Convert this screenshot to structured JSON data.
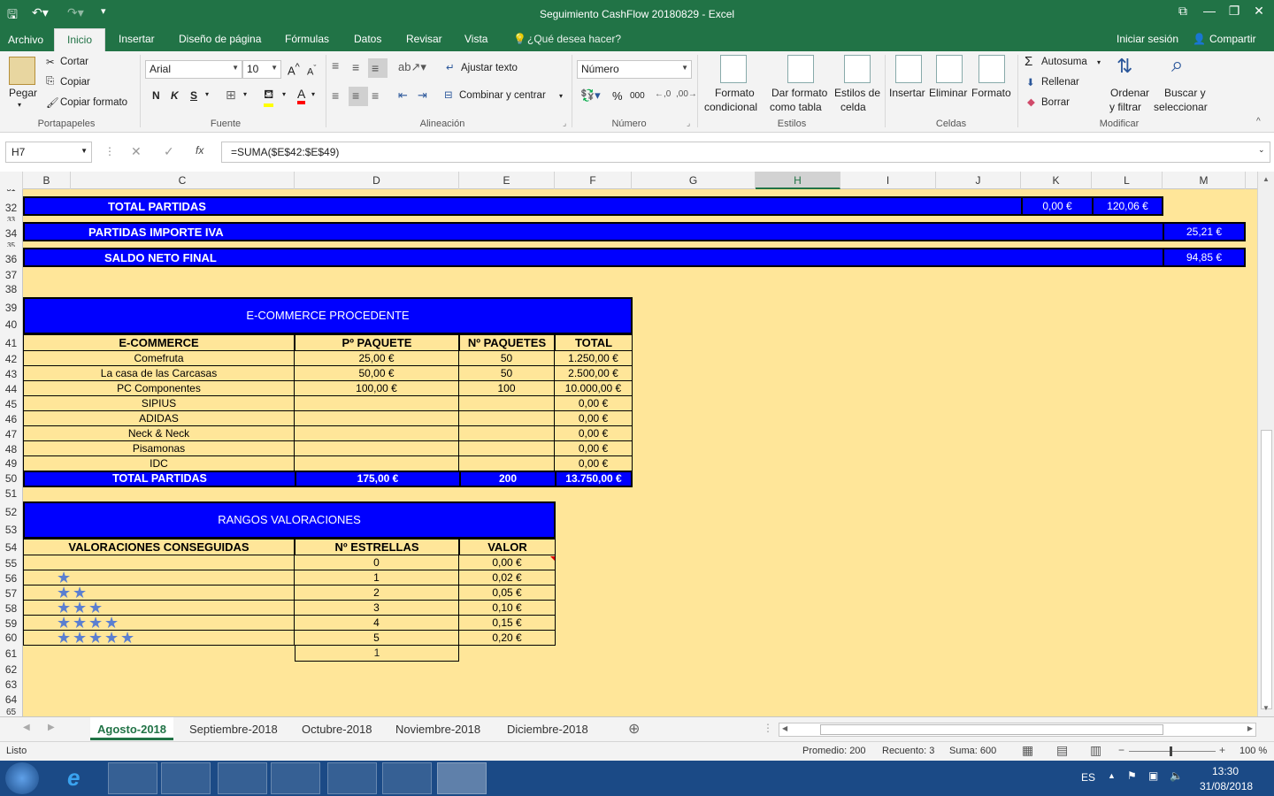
{
  "window": {
    "title": "Seguimiento CashFlow 20180829 - Excel"
  },
  "ribbon_tabs": [
    "Archivo",
    "Inicio",
    "Insertar",
    "Diseño de página",
    "Fórmulas",
    "Datos",
    "Revisar",
    "Vista"
  ],
  "tell_me": "¿Qué desea hacer?",
  "signin": "Iniciar sesión",
  "share": "Compartir",
  "clipboard": {
    "paste": "Pegar",
    "cut": "Cortar",
    "copy": "Copiar",
    "format_painter": "Copiar formato",
    "label": "Portapapeles"
  },
  "font": {
    "name": "Arial",
    "size": "10",
    "label": "Fuente",
    "bold": "N",
    "italic": "K",
    "underline": "S"
  },
  "alignment": {
    "wrap": "Ajustar texto",
    "merge": "Combinar y centrar",
    "label": "Alineación"
  },
  "number": {
    "format": "Número",
    "label": "Número",
    "percent": "%",
    "thousands": "000"
  },
  "styles": {
    "cond1": "Formato",
    "cond2": "condicional",
    "table1": "Dar formato",
    "table2": "como tabla",
    "cell1": "Estilos de",
    "cell2": "celda",
    "label": "Estilos"
  },
  "cells": {
    "insert": "Insertar",
    "delete": "Eliminar",
    "format": "Formato",
    "label": "Celdas"
  },
  "editing": {
    "autosum": "Autosuma",
    "fill": "Rellenar",
    "clear": "Borrar",
    "sort1": "Ordenar",
    "sort2": "y filtrar",
    "find1": "Buscar y",
    "find2": "seleccionar",
    "label": "Modificar"
  },
  "formula_bar": {
    "name_box": "H7",
    "fx": "fx",
    "formula": "=SUMA($E$42:$E$49)"
  },
  "columns": [
    "B",
    "C",
    "D",
    "E",
    "F",
    "G",
    "H",
    "I",
    "J",
    "K",
    "L",
    "M"
  ],
  "rows": [
    "31",
    "32",
    "33",
    "34",
    "35",
    "36",
    "37",
    "38",
    "39",
    "40",
    "41",
    "42",
    "43",
    "44",
    "45",
    "46",
    "47",
    "48",
    "49",
    "50",
    "51",
    "52",
    "53",
    "54",
    "55",
    "56",
    "57",
    "58",
    "59",
    "60",
    "61",
    "62",
    "63",
    "64",
    "65"
  ],
  "summary": {
    "total_partidas": "TOTAL PARTIDAS",
    "k32": "0,00 €",
    "l32": "120,06 €",
    "iva": "PARTIDAS IMPORTE IVA",
    "m34": "25,21 €",
    "saldo": "SALDO NETO FINAL",
    "m36": "94,85 €"
  },
  "ecommerce": {
    "title": "E-COMMERCE PROCEDENTE",
    "headers": [
      "E-COMMERCE",
      "Pº PAQUETE",
      "Nº PAQUETES",
      "TOTAL"
    ],
    "rows": [
      [
        "Comefruta",
        "25,00 €",
        "50",
        "1.250,00 €"
      ],
      [
        "La casa de las Carcasas",
        "50,00 €",
        "50",
        "2.500,00 €"
      ],
      [
        "PC Componentes",
        "100,00 €",
        "100",
        "10.000,00 €"
      ],
      [
        "SIPIUS",
        "",
        "",
        "0,00 €"
      ],
      [
        "ADIDAS",
        "",
        "",
        "0,00 €"
      ],
      [
        "Neck & Neck",
        "",
        "",
        "0,00 €"
      ],
      [
        "Pisamonas",
        "",
        "",
        "0,00 €"
      ],
      [
        "IDC",
        "",
        "",
        "0,00 €"
      ]
    ],
    "total": [
      "TOTAL PARTIDAS",
      "175,00 €",
      "200",
      "13.750,00 €"
    ]
  },
  "ratings": {
    "title": "RANGOS VALORACIONES",
    "headers": [
      "VALORACIONES CONSEGUIDAS",
      "Nº ESTRELLAS",
      "VALOR"
    ],
    "rows": [
      {
        "stars": 0,
        "n": "0",
        "v": "0,00 €"
      },
      {
        "stars": 1,
        "n": "1",
        "v": "0,02 €"
      },
      {
        "stars": 2,
        "n": "2",
        "v": "0,05 €"
      },
      {
        "stars": 3,
        "n": "3",
        "v": "0,10 €"
      },
      {
        "stars": 4,
        "n": "4",
        "v": "0,15 €"
      },
      {
        "stars": 5,
        "n": "5",
        "v": "0,20 €"
      }
    ],
    "extra": "1"
  },
  "sheet_tabs": [
    "Agosto-2018",
    "Septiembre-2018",
    "Octubre-2018",
    "Noviembre-2018",
    "Diciembre-2018"
  ],
  "status": {
    "ready": "Listo",
    "avg": "Promedio: 200",
    "count": "Recuento: 3",
    "sum": "Suma: 600",
    "zoom": "100 %"
  },
  "taskbar": {
    "lang": "ES",
    "time": "13:30",
    "date": "31/08/2018"
  },
  "colors": {
    "excel_green": "#217346",
    "sheet_bg": "#ffe699",
    "band_blue": "#0000ff",
    "taskbar": "#1b4a86"
  }
}
